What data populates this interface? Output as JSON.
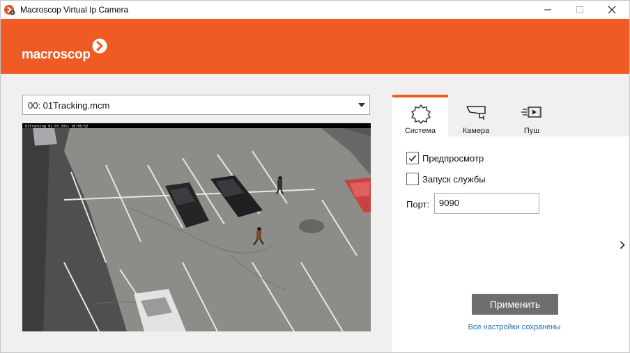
{
  "window": {
    "title": "Macroscop Virtual Ip Camera",
    "controls": {
      "minimize": "minimize-icon",
      "maximize": "maximize-icon",
      "close": "close-icon"
    }
  },
  "header": {
    "logo_text": "macroscop",
    "brand_color": "#f05a24"
  },
  "left": {
    "file_select": {
      "value": "00: 01Tracking.mcm"
    },
    "preview": {
      "overlay_text": "01Tracking  01.03.2011  10:56:52"
    }
  },
  "tabs": [
    {
      "label": "Система",
      "icon": "gear-icon",
      "active": true
    },
    {
      "label": "Камера",
      "icon": "camera-icon",
      "active": false
    },
    {
      "label": "Пуш",
      "icon": "push-video-icon",
      "active": false
    }
  ],
  "system_panel": {
    "preview_label": "Предпросмотр",
    "preview_checked": true,
    "service_label": "Запуск службы",
    "service_checked": false,
    "port_label": "Порт:",
    "port_value": "9090",
    "apply_label": "Применить",
    "status_text": "Все настройки сохранены",
    "status_color": "#1f6fb5"
  },
  "nav": {
    "next_icon": "chevron-right-icon"
  }
}
